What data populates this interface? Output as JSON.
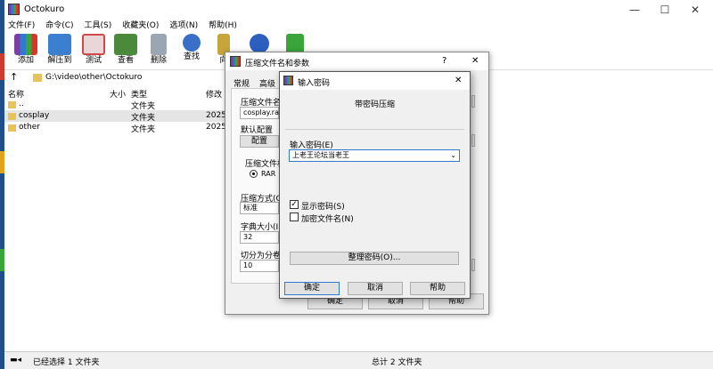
{
  "window": {
    "title": "Octokuro",
    "minimize": "—",
    "maximize": "☐",
    "close": "✕"
  },
  "menu": [
    "文件(F)",
    "命令(C)",
    "工具(S)",
    "收藏夹(O)",
    "选项(N)",
    "帮助(H)"
  ],
  "toolbar": [
    {
      "label": "添加",
      "icon": "add-icon",
      "color": "#c83a2a"
    },
    {
      "label": "解压到",
      "icon": "extract-folder-icon",
      "color": "#3a7fd0"
    },
    {
      "label": "测试",
      "icon": "test-icon",
      "color": "#d04848"
    },
    {
      "label": "查看",
      "icon": "view-book-icon",
      "color": "#4a8a3a"
    },
    {
      "label": "删除",
      "icon": "trash-icon",
      "color": "#7a8a99"
    },
    {
      "label": "查找",
      "icon": "magnifier-icon",
      "color": "#3a6fc8"
    },
    {
      "label": "向",
      "icon": "wizard-icon",
      "color": "#c8a53a"
    }
  ],
  "address": {
    "up": "↑",
    "path": "G:\\video\\other\\Octokuro"
  },
  "columns": {
    "name": "名称",
    "size": "大小",
    "type": "类型",
    "modified": "修改"
  },
  "rows": [
    {
      "name": "..",
      "type": "文件夹",
      "modified": ""
    },
    {
      "name": "cosplay",
      "type": "文件夹",
      "modified": "2025/"
    },
    {
      "name": "other",
      "type": "文件夹",
      "modified": "2025/"
    }
  ],
  "status": {
    "left": "已经选择 1 文件夹",
    "right": "总计 2 文件夹"
  },
  "dialog_back": {
    "title": "压缩文件名和参数",
    "help": "?",
    "close": "✕",
    "tab_general": "常规",
    "tab_advanced": "高级",
    "archive_name_label": "压缩文件名",
    "archive_name_value": "cosplay.rar",
    "default_profile_label": "默认配置",
    "profile_button": "配置",
    "format_label": "压缩文件格",
    "format_rar": "RAR",
    "method_label": "压缩方式(C",
    "method_value": "标准",
    "dict_label": "字典大小(I",
    "dict_value": "32",
    "split_label": "切分为分卷",
    "split_value": "10",
    "ok": "确定",
    "cancel": "取消",
    "help_btn": "帮助"
  },
  "dialog_pwd": {
    "title": "输入密码",
    "close": "✕",
    "heading": "带密码压缩",
    "enter_label": "输入密码(E)",
    "password_value": "上老王论坛当老王",
    "show_password": "显示密码(S)",
    "show_password_checked": true,
    "encrypt_names": "加密文件名(N)",
    "encrypt_names_checked": false,
    "organize": "整理密码(O)...",
    "ok": "确定",
    "cancel": "取消",
    "help": "帮助"
  }
}
